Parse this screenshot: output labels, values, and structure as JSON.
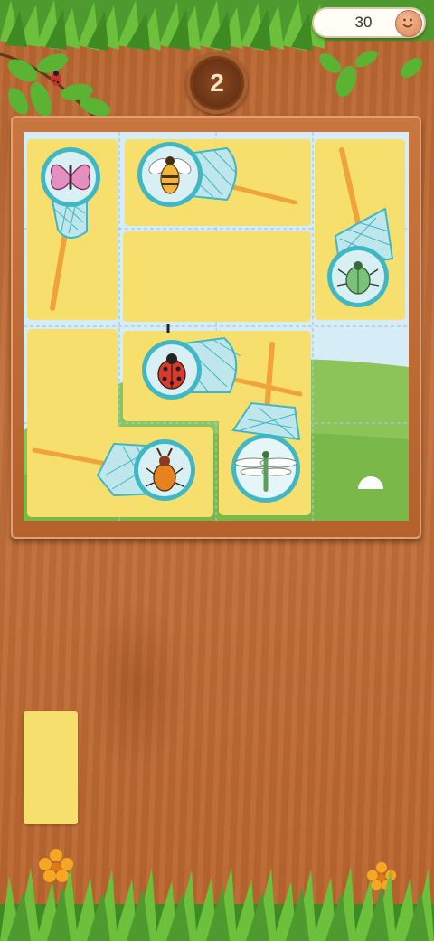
{
  "hud": {
    "score": "30",
    "level": "2"
  },
  "icons": {
    "score_coin": "smiley-coin-icon",
    "ladybug_decor": "ladybug-icon"
  },
  "colors": {
    "tile_yellow": "#f6df6c",
    "net_teal": "#3fb7c5",
    "handle_orange": "#f0a33a",
    "wood": "#c2703a",
    "sky": "#d6ecf7",
    "hill": "#8cc45a"
  },
  "board": {
    "grid": {
      "rows": 4,
      "cols": 4
    },
    "insects": [
      {
        "name": "butterfly",
        "net_direction": "down"
      },
      {
        "name": "bee",
        "net_direction": "right"
      },
      {
        "name": "beetle",
        "net_direction": "up"
      },
      {
        "name": "ladybug",
        "net_direction": "right"
      },
      {
        "name": "dragonfly",
        "net_direction": "up"
      },
      {
        "name": "stag-beetle",
        "net_direction": "left"
      }
    ]
  },
  "tray": {
    "pieces": 1
  }
}
